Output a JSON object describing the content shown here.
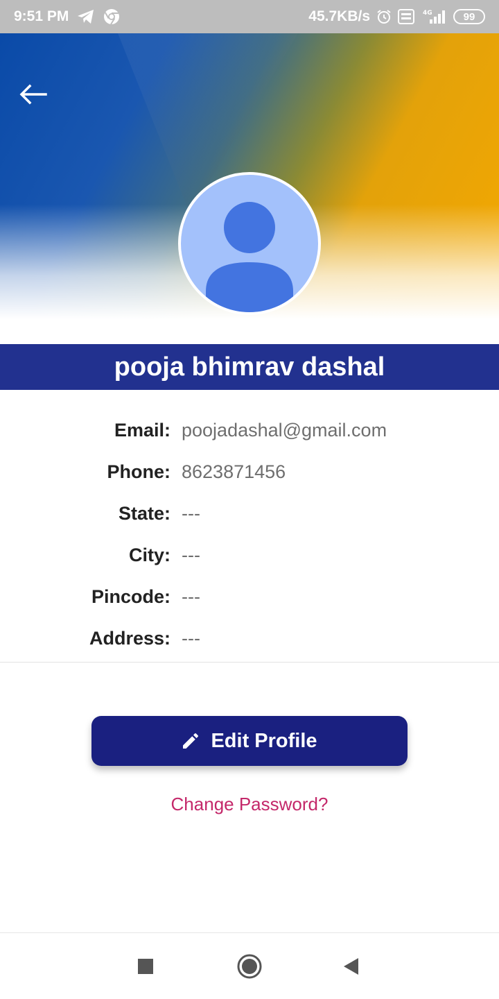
{
  "status_bar": {
    "time": "9:51 PM",
    "net_speed": "45.7KB/s",
    "network": "4G",
    "battery": "99",
    "icons": [
      "telegram-icon",
      "chrome-icon",
      "alarm-icon",
      "volte-icon",
      "signal-icon",
      "battery-icon"
    ]
  },
  "header": {
    "back_icon": "arrow-left-icon",
    "colors": {
      "blue": "#0a4aa8",
      "orange": "#f5a800"
    }
  },
  "profile": {
    "name": "pooja bhimrav dashal",
    "avatar_icon": "person-avatar-icon",
    "details": [
      {
        "label": "Email:",
        "value": "poojadashal@gmail.com"
      },
      {
        "label": "Phone:",
        "value": "8623871456"
      },
      {
        "label": "State:",
        "value": "---"
      },
      {
        "label": "City:",
        "value": "---"
      },
      {
        "label": "Pincode:",
        "value": "---"
      },
      {
        "label": "Address:",
        "value": "---"
      }
    ]
  },
  "actions": {
    "edit_label": "Edit Profile",
    "edit_icon": "pencil-icon",
    "change_password": "Change Password?"
  },
  "colors": {
    "name_bar": "#22318f",
    "button": "#1a2080",
    "link": "#c4286a"
  },
  "nav": {
    "recents_icon": "square-icon",
    "home_icon": "circle-icon",
    "back_icon": "triangle-back-icon"
  }
}
